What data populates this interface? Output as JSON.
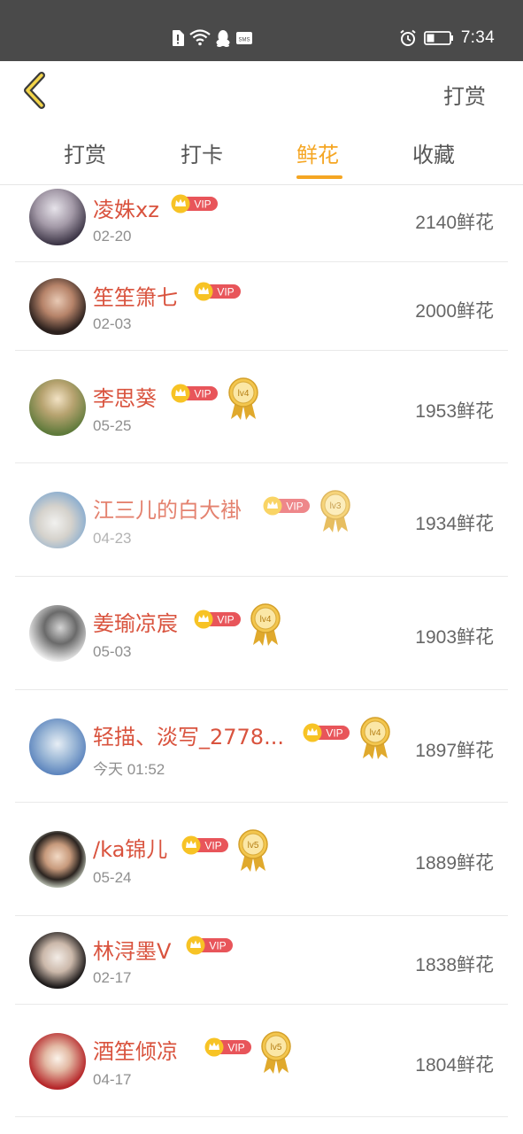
{
  "status_bar": {
    "time": "7:34",
    "icons": [
      "sim-alert-icon",
      "wifi-icon",
      "qq-penguin-icon",
      "sms-icon",
      "alarm-icon",
      "battery-icon"
    ],
    "sms_label": "SMS"
  },
  "header": {
    "back_icon": "chevron-left-icon",
    "action_label": "打赏"
  },
  "tabs": [
    {
      "label": "打赏",
      "active": false
    },
    {
      "label": "打卡",
      "active": false
    },
    {
      "label": "鲜花",
      "active": true
    },
    {
      "label": "收藏",
      "active": false
    }
  ],
  "vip_label": "VIP",
  "list": [
    {
      "name": "凌姝xz",
      "date": "02-20",
      "amount": "2140鲜花",
      "level": null
    },
    {
      "name": "笙笙箫七",
      "date": "02-03",
      "amount": "2000鲜花",
      "level": null
    },
    {
      "name": "李思葵",
      "date": "05-25",
      "amount": "1953鲜花",
      "level": "lv4"
    },
    {
      "name": "江三儿的白大褂",
      "date": "04-23",
      "amount": "1934鲜花",
      "level": "lv3"
    },
    {
      "name": "姜瑜凉宸",
      "date": "05-03",
      "amount": "1903鲜花",
      "level": "lv4"
    },
    {
      "name": "轻描、淡写_2778...",
      "date": "今天 01:52",
      "amount": "1897鲜花",
      "level": "lv4"
    },
    {
      "name": "/ka锦儿",
      "date": "05-24",
      "amount": "1889鲜花",
      "level": "lv5"
    },
    {
      "name": "林浔墨V",
      "date": "02-17",
      "amount": "1838鲜花",
      "level": null
    },
    {
      "name": "酒笙倾凉",
      "date": "04-17",
      "amount": "1804鲜花",
      "level": "lv5"
    }
  ],
  "colors": {
    "accent": "#f5a623",
    "name": "#d9533e",
    "vip_badge": "#e8555a",
    "crown": "#f7c325",
    "statusbar": "#4a4a4a"
  }
}
